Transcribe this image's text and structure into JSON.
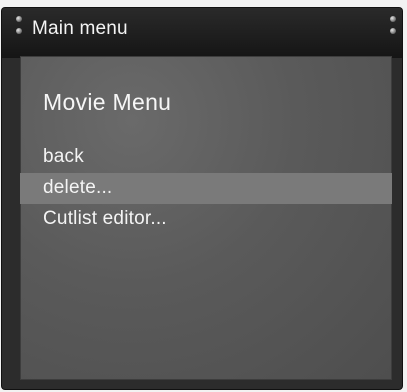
{
  "window": {
    "title": "Main menu"
  },
  "menu": {
    "title": "Movie Menu",
    "items": [
      {
        "label": "back",
        "selected": false
      },
      {
        "label": "delete...",
        "selected": true
      },
      {
        "label": "Cutlist editor...",
        "selected": false
      }
    ]
  },
  "colors": {
    "window_bg": "#2c2c2c",
    "panel_bg": "#5a5a5a",
    "selection": "#7a7a7a",
    "text": "#f4f4f4"
  }
}
